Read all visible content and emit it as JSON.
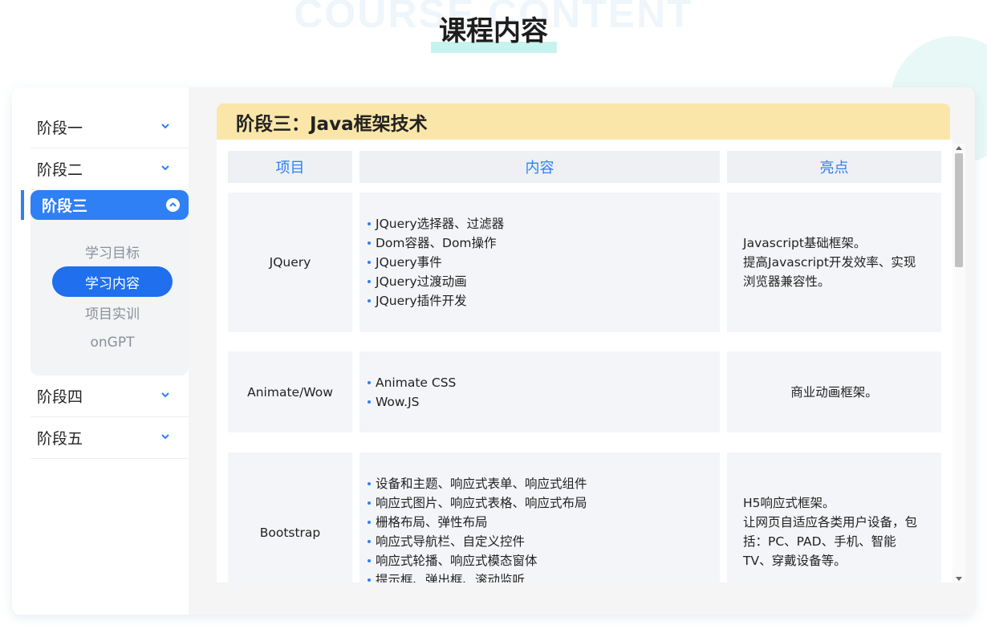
{
  "header": {
    "bg_word": "COURSE CONTENT",
    "title": "课程内容"
  },
  "sidebar": {
    "stages_before": [
      {
        "label": "阶段一"
      },
      {
        "label": "阶段二"
      }
    ],
    "active_stage": {
      "label": "阶段三",
      "submenu": [
        {
          "label": "学习目标",
          "active": false
        },
        {
          "label": "学习内容",
          "active": true
        },
        {
          "label": "项目实训",
          "active": false
        },
        {
          "label": "onGPT",
          "active": false
        }
      ]
    },
    "stages_after": [
      {
        "label": "阶段四"
      },
      {
        "label": "阶段五"
      }
    ]
  },
  "content": {
    "heading": "阶段三：Java框架技术",
    "table": {
      "headers": [
        "项目",
        "内容",
        "亮点"
      ],
      "rows": [
        {
          "project": "JQuery",
          "items": [
            "JQuery选择器、过滤器",
            "Dom容器、Dom操作",
            "JQuery事件",
            "JQuery过渡动画",
            "JQuery插件开发"
          ],
          "highlight": [
            "Javascript基础框架。",
            "提高Javascript开发效率、实现",
            "浏览器兼容性。"
          ]
        },
        {
          "project": "Animate/Wow",
          "items": [
            "Animate CSS",
            "Wow.JS"
          ],
          "highlight": [
            "商业动画框架。"
          ]
        },
        {
          "project": "Bootstrap",
          "items": [
            "设备和主题、响应式表单、响应式组件",
            "响应式图片、响应式表格、响应式布局",
            "栅格布局、弹性布局",
            "响应式导航栏、自定义控件",
            "响应式轮播、响应式模态窗体",
            "提示框、弹出框、滚动监听"
          ],
          "highlight": [
            "H5响应式框架。",
            "让网页自适应各类用户设备，包",
            "括：PC、PAD、手机、智能",
            "TV、穿戴设备等。"
          ]
        }
      ]
    }
  },
  "colors": {
    "accent": "#2f7ff5",
    "heading_bg": "#fae6a8",
    "title_underline": "#c7f3ee"
  }
}
